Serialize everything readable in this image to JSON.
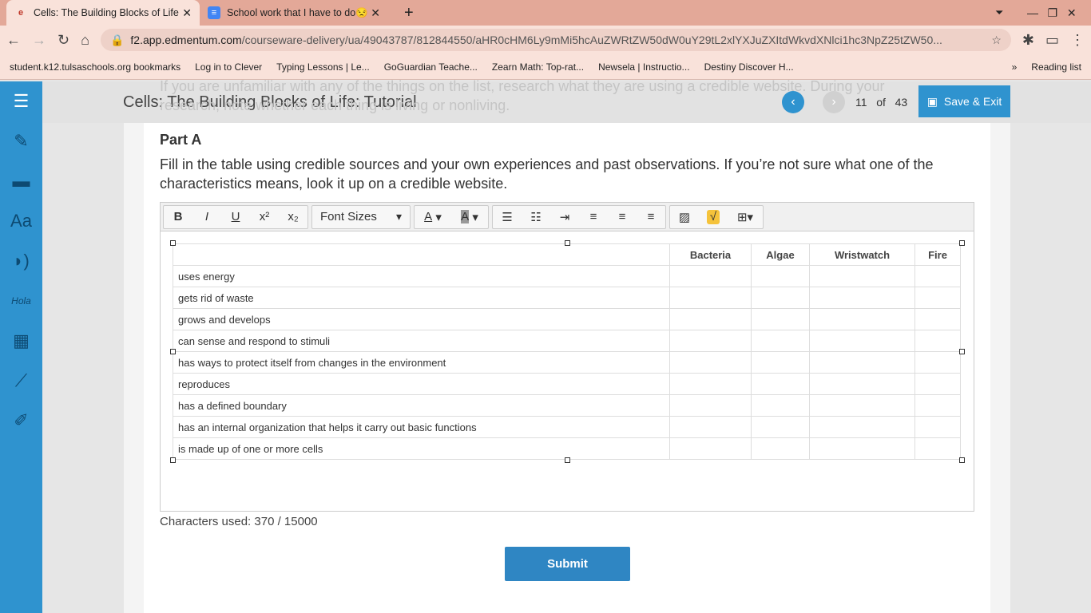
{
  "browser": {
    "tabs": [
      {
        "title": "Cells: The Building Blocks of Life"
      },
      {
        "title": "School work that I have to do😒"
      }
    ],
    "url_host": "f2.app.edmentum.com",
    "url_path": "/courseware-delivery/ua/49043787/812844550/aHR0cHM6Ly9mMi5hcAuZWRtZW50dW0uY29tL2xlYXJuZXItdWkvdXNlci1hc3NpZ25tZW50...",
    "bookmarks": [
      "student.k12.tulsaschools.org bookmarks",
      "Log in to Clever",
      "Typing Lessons | Le...",
      "GoGuardian Teache...",
      "Zearn Math: Top-rat...",
      "Newsela | Instructio...",
      "Destiny Discover H..."
    ],
    "reading_list": "Reading list"
  },
  "header": {
    "title": "Cells: The Building Blocks of Life: Tutorial",
    "page": "11",
    "of": "of",
    "total": "43",
    "save_exit": "Save & Exit",
    "background_text": "If you are unfamiliar with any of the things on the list, research what they are using a credible website. During your research, note whether each thing is living or nonliving."
  },
  "content": {
    "part": "Part A",
    "instructions": "Fill in the table using credible sources and your own experiences and past observations. If you’re not sure what one of the characteristics means, look it up on a credible website.",
    "font_sizes": "Font Sizes",
    "table": {
      "columns": [
        "",
        "Bacteria",
        "Algae",
        "Wristwatch",
        "Fire"
      ],
      "rows": [
        "uses energy",
        "gets rid of waste",
        "grows and develops",
        "can sense and respond to stimuli",
        "has ways to protect itself from changes in the environment",
        "reproduces",
        "has a defined boundary",
        "has an internal organization that helps it carry out basic functions",
        "is made up of one or more cells"
      ]
    },
    "characters_used": "Characters used: 370 / 15000",
    "submit": "Submit"
  }
}
